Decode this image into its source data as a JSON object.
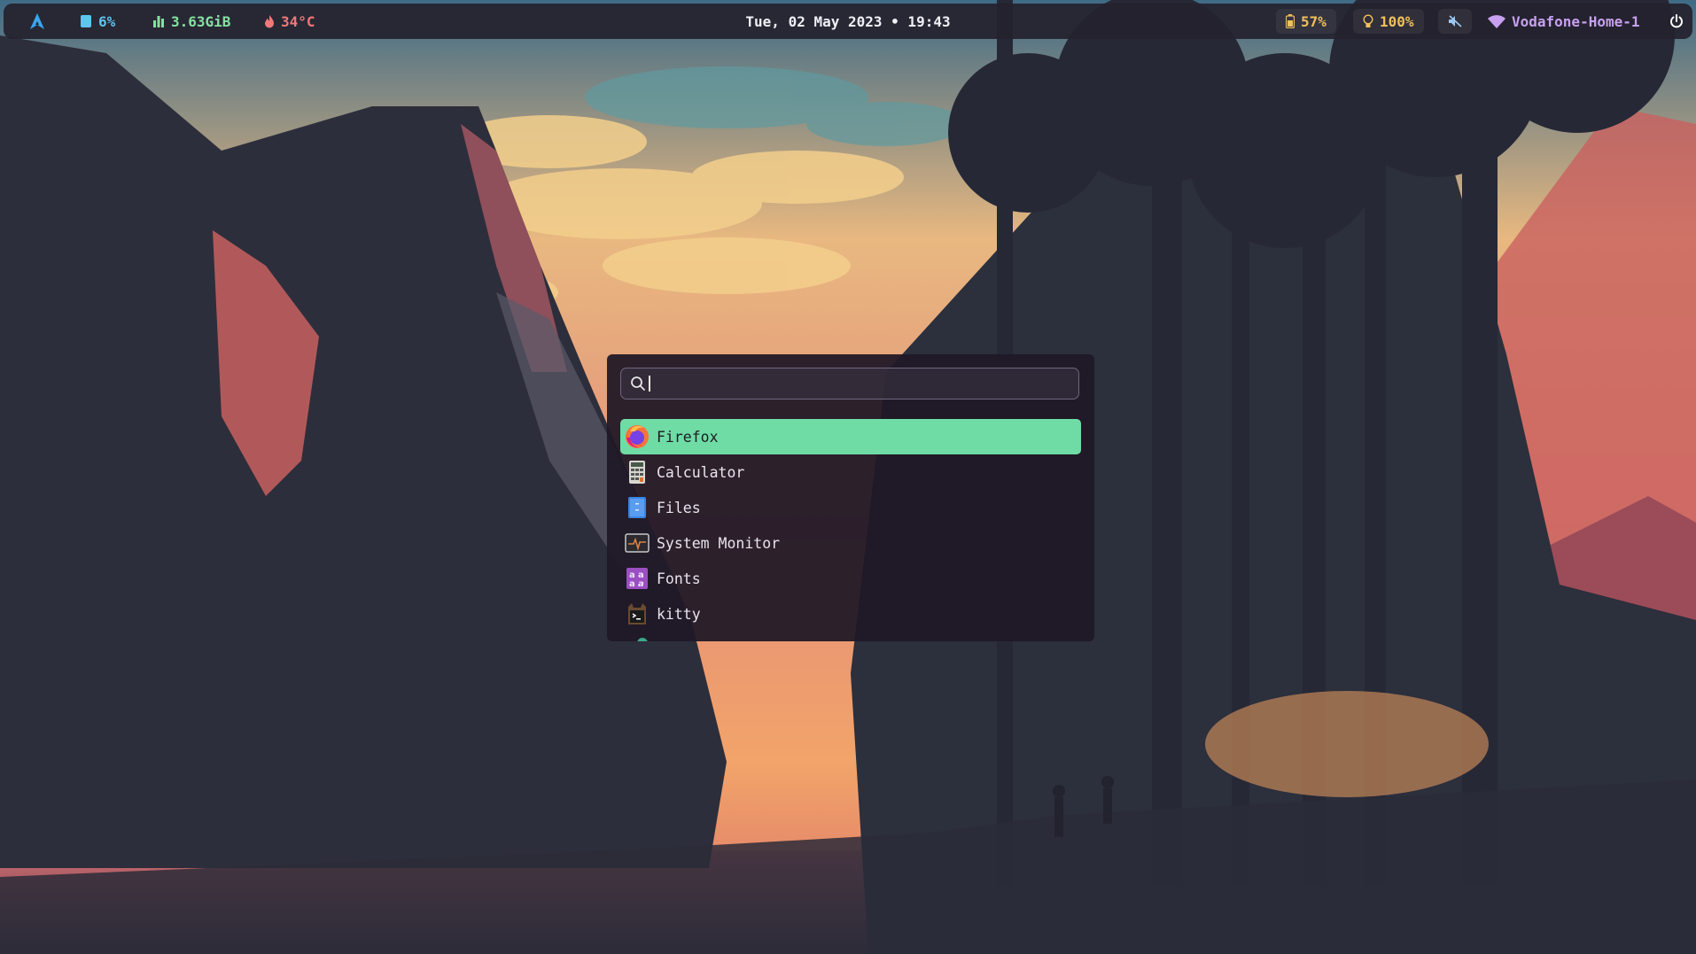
{
  "topbar": {
    "launcher_icon": "arch-logo-icon",
    "cpu": {
      "icon": "cpu-icon",
      "value": "6%"
    },
    "memory": {
      "icon": "memory-bars-icon",
      "value": "3.63GiB"
    },
    "temperature": {
      "icon": "flame-icon",
      "value": "34°C"
    },
    "clock": "Tue, 02 May 2023 • 19:43",
    "battery": {
      "icon": "battery-icon",
      "value": "57%"
    },
    "brightness": {
      "icon": "bulb-icon",
      "value": "100%"
    },
    "volume": {
      "icon": "volume-muted-icon"
    },
    "wifi": {
      "icon": "wifi-icon",
      "network": "Vodafone-Home-1"
    },
    "power_icon": "power-icon"
  },
  "launcher": {
    "search": {
      "value": "",
      "icon": "search-icon"
    },
    "apps": [
      {
        "label": "Firefox",
        "icon": "firefox-icon",
        "selected": true
      },
      {
        "label": "Calculator",
        "icon": "calculator-icon",
        "selected": false
      },
      {
        "label": "Files",
        "icon": "files-icon",
        "selected": false
      },
      {
        "label": "System Monitor",
        "icon": "system-monitor-icon",
        "selected": false
      },
      {
        "label": "Fonts",
        "icon": "fonts-icon",
        "selected": false
      },
      {
        "label": "kitty",
        "icon": "kitty-icon",
        "selected": false
      }
    ]
  },
  "colors": {
    "selected_item": "#6fdca6",
    "bar_background": "#24222e",
    "launcher_background": "#201826"
  }
}
